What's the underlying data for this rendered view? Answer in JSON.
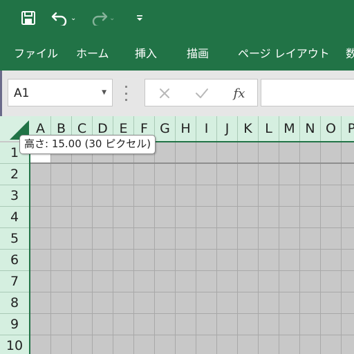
{
  "quick_access": {
    "save_icon": "save-icon",
    "undo_icon": "undo-icon",
    "redo_icon": "redo-icon",
    "customize_icon": "customize-qat-icon"
  },
  "ribbon": {
    "tabs": [
      {
        "label": "ファイル"
      },
      {
        "label": "ホーム"
      },
      {
        "label": "挿入"
      },
      {
        "label": "描画"
      },
      {
        "label": "ページ レイアウト"
      },
      {
        "label": "数"
      }
    ]
  },
  "formula_bar": {
    "name_box_value": "A1",
    "cancel_icon": "cancel-icon",
    "enter_icon": "enter-check-icon",
    "fx_label": "fx",
    "formula_value": ""
  },
  "sheet": {
    "columns": [
      "A",
      "B",
      "C",
      "D",
      "E",
      "F",
      "G",
      "H",
      "I",
      "J",
      "K",
      "L",
      "M",
      "N",
      "O",
      "P"
    ],
    "rows": [
      "1",
      "2",
      "3",
      "4",
      "5",
      "6",
      "7",
      "8",
      "9",
      "10"
    ],
    "tooltip": "高さ: 15.00 (30 ピクセル)"
  },
  "colors": {
    "brand": "#217346",
    "header_bg": "#d5efe0",
    "grid_bg": "#c8c8c8"
  }
}
